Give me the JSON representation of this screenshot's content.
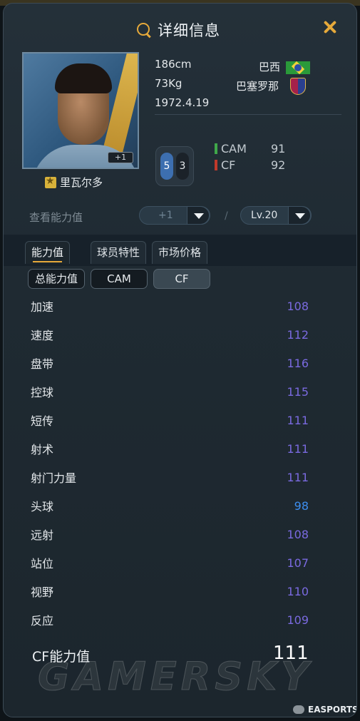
{
  "header": {
    "title": "详细信息"
  },
  "player": {
    "name": "里瓦尔多",
    "height": "186cm",
    "weight": "73Kg",
    "birthdate": "1972.4.19",
    "nation": "巴西",
    "club": "巴塞罗那",
    "portrait_badge": "+1",
    "skill_a": "5",
    "skill_b": "3"
  },
  "positions": [
    {
      "pos": "CAM",
      "value": "91",
      "color": "#3fa84a"
    },
    {
      "pos": "CF",
      "value": "92",
      "color": "#c0392b"
    }
  ],
  "controls": {
    "view_label": "查看能力值",
    "upgrade_value": "+1",
    "slash": "/",
    "level_value": "Lv.20"
  },
  "tabs": [
    {
      "label": "能力值",
      "active": true
    },
    {
      "label": "球员特性",
      "active": false
    },
    {
      "label": "市场价格",
      "active": false
    }
  ],
  "subtabs": [
    {
      "label": "总能力值",
      "active": false
    },
    {
      "label": "CAM",
      "active": false
    },
    {
      "label": "CF",
      "active": true
    }
  ],
  "stats": [
    {
      "label": "加速",
      "value": "108"
    },
    {
      "label": "速度",
      "value": "112"
    },
    {
      "label": "盘带",
      "value": "116"
    },
    {
      "label": "控球",
      "value": "115"
    },
    {
      "label": "短传",
      "value": "111"
    },
    {
      "label": "射术",
      "value": "111"
    },
    {
      "label": "射门力量",
      "value": "111"
    },
    {
      "label": "头球",
      "value": "98"
    },
    {
      "label": "远射",
      "value": "108"
    },
    {
      "label": "站位",
      "value": "107"
    },
    {
      "label": "视野",
      "value": "110"
    },
    {
      "label": "反应",
      "value": "109"
    }
  ],
  "total": {
    "label": "CF能力值",
    "value": "111"
  },
  "footer": {
    "watermark": "GAMERSKY",
    "account": "EASPORTS"
  },
  "colors": {
    "accent": "#e6a93a",
    "stat_value": "#7a6ae0",
    "stat_value_low": "#3d8ef0"
  }
}
